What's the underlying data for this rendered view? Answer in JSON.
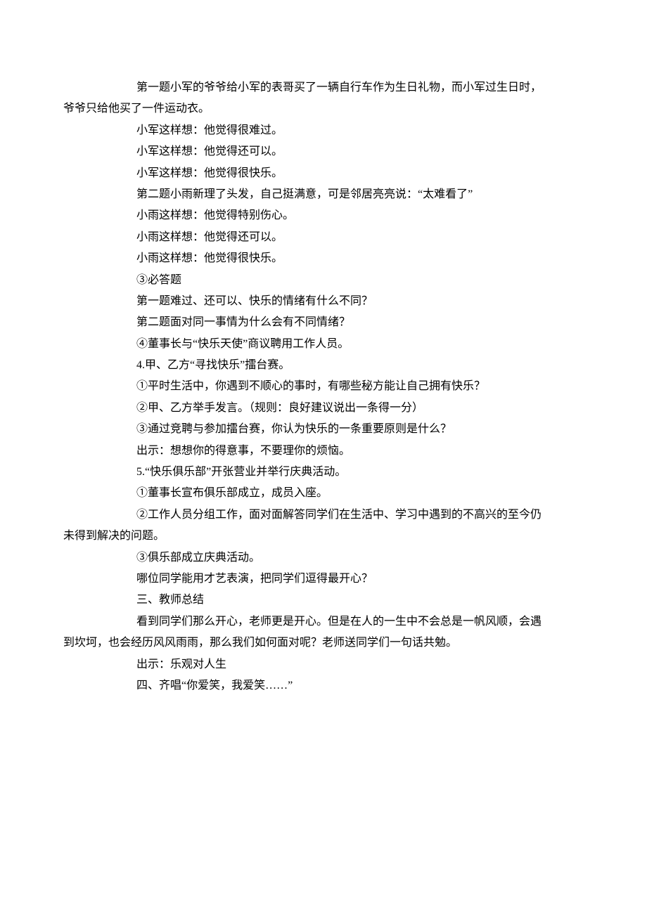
{
  "lines": [
    {
      "cls": "para indent",
      "key": "l0"
    },
    {
      "cls": "para wrap",
      "key": "l1"
    },
    {
      "cls": "para indent",
      "key": "l2"
    },
    {
      "cls": "para indent",
      "key": "l3"
    },
    {
      "cls": "para indent",
      "key": "l4"
    },
    {
      "cls": "para indent",
      "key": "l5"
    },
    {
      "cls": "para indent",
      "key": "l6"
    },
    {
      "cls": "para indent",
      "key": "l7"
    },
    {
      "cls": "para indent",
      "key": "l8"
    },
    {
      "cls": "para indent",
      "key": "l9"
    },
    {
      "cls": "para indent",
      "key": "l10"
    },
    {
      "cls": "para indent",
      "key": "l11"
    },
    {
      "cls": "para indent",
      "key": "l12"
    },
    {
      "cls": "para indent",
      "key": "l13"
    },
    {
      "cls": "para indent",
      "key": "l14"
    },
    {
      "cls": "para indent",
      "key": "l15"
    },
    {
      "cls": "para indent",
      "key": "l16"
    },
    {
      "cls": "para indent",
      "key": "l17"
    },
    {
      "cls": "para indent",
      "key": "l18"
    },
    {
      "cls": "para indent",
      "key": "l19"
    },
    {
      "cls": "para indent",
      "key": "l20"
    },
    {
      "cls": "para indent",
      "key": "l21"
    },
    {
      "cls": "para wrap",
      "key": "l22"
    },
    {
      "cls": "para indent",
      "key": "l23"
    },
    {
      "cls": "para indent",
      "key": "l24"
    },
    {
      "cls": "para indent",
      "key": "l25"
    },
    {
      "cls": "para indent",
      "key": "l26"
    },
    {
      "cls": "para wrap",
      "key": "l27"
    },
    {
      "cls": "para indent",
      "key": "l28"
    },
    {
      "cls": "para indent",
      "key": "l29"
    }
  ],
  "text": {
    "l0": "第一题小军的爷爷给小军的表哥买了一辆自行车作为生日礼物，而小军过生日时，",
    "l1": "爷爷只给他买了一件运动衣。",
    "l2": "小军这样想：他觉得很难过。",
    "l3": "小军这样想：他觉得还可以。",
    "l4": "小军这样想：他觉得很快乐。",
    "l5": "第二题小雨新理了头发，自己挺满意，可是邻居亮亮说：“太难看了”",
    "l6": "小雨这样想：他觉得特别伤心。",
    "l7": "小雨这样想：他觉得还可以。",
    "l8": "小雨这样想：他觉得很快乐。",
    "l9": "③必答题",
    "l10": "第一题难过、还可以、快乐的情绪有什么不同？",
    "l11": "第二题面对同一事情为什么会有不同情绪？",
    "l12": "④董事长与“快乐天使”商议聘用工作人员。",
    "l13": "4.甲、乙方“寻找快乐”擂台赛。",
    "l14": "①平时生活中，你遇到不顺心的事时，有哪些秘方能让自己拥有快乐？",
    "l15": "②甲、乙方举手发言。（规则：良好建议说出一条得一分）",
    "l16": "③通过竞聘与参加擂台赛，你认为快乐的一条重要原则是什么？",
    "l17": "出示：想想你的得意事，不要理你的烦恼。",
    "l18": "5.“快乐俱乐部”开张营业并举行庆典活动。",
    "l19": "①董事长宣布俱乐部成立，成员入座。",
    "l20": "②工作人员分组工作，面对面解答同学们在生活中、学习中遇到的不高兴的至今仍",
    "l21": "③俱乐部成立庆典活动。",
    "l22": "未得到解决的问题。",
    "l23": "哪位同学能用才艺表演，把同学们逗得最开心？",
    "l24": "三、教师总结",
    "l25": "看到同学们那么开心，老师更是开心。但是在人的一生中不会总是一帆风顺，会遇",
    "l26": "出示：乐观对人生",
    "l27": "到坎坷，也会经历风风雨雨，那么我们如何面对呢？老师送同学们一句话共勉。",
    "l28": "四、齐唱“你爱笑，我爱笑……”",
    "l29": ""
  },
  "order": [
    "l0",
    "l1",
    "l2",
    "l3",
    "l4",
    "l5",
    "l6",
    "l7",
    "l8",
    "l9",
    "l10",
    "l11",
    "l12",
    "l13",
    "l14",
    "l15",
    "l16",
    "l17",
    "l18",
    "l19",
    "l20",
    "l22",
    "l21",
    "l23",
    "l24",
    "l25",
    "l27",
    "l26",
    "l28"
  ]
}
